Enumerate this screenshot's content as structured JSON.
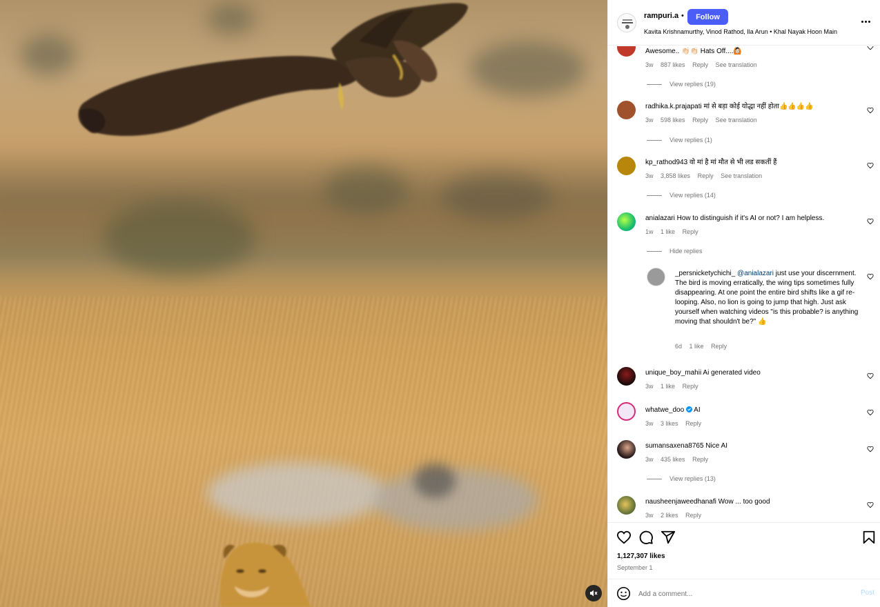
{
  "post": {
    "username": "rampuri.a",
    "separator": "•",
    "follow_label": "Follow",
    "audio": "Kavita Krishnamurthy, Vinod Rathod, Ila Arun • Khal Nayak Hoon Main",
    "avatar_icon": "profile-avatar-icon",
    "more_icon": "more-options-icon"
  },
  "comments": [
    {
      "username": "",
      "text": "Awesome.. 👏🏻👏🏻 Hats Off....🙆🏻",
      "time": "3w",
      "likes": "887 likes",
      "reply": "Reply",
      "translation": "See translation",
      "replies": "View replies (19)",
      "avatar_color": "#c0392b"
    },
    {
      "username": "radhika.k.prajapati",
      "text": "मां से बड़ा कोई योद्धा नहीं होता👍👍👍👍",
      "time": "3w",
      "likes": "598 likes",
      "reply": "Reply",
      "translation": "See translation",
      "replies": "View replies (1)",
      "avatar_color": "#a0522d"
    },
    {
      "username": "kp_rathod943",
      "text": "वो मां है मां मौत से भी लड सकतीं हैं",
      "time": "3w",
      "likes": "3,858 likes",
      "reply": "Reply",
      "translation": "See translation",
      "replies": "View replies (14)",
      "avatar_color": "#b8860b"
    },
    {
      "username": "anialazari",
      "text": "How to distinguish if it's AI or not? I am helpless.",
      "time": "1w",
      "likes": "1 like",
      "reply": "Reply",
      "replies": "Hide replies",
      "avatar_color": "#2ecc71"
    },
    {
      "username": "_persnicketychichi_",
      "mention": "@anialazari",
      "text": "just use your discernment. The bird is moving erratically, the wing tips sometimes fully disappearing. At one point the entire bird shifts like a gif re-looping. Also, no lion is going to jump that high. Just ask yourself when watching videos \"is this probable? is anything moving that shouldn't be?\" 👍",
      "time": "6d",
      "likes": "1 like",
      "reply": "Reply",
      "avatar_color": "#8e8e8e"
    },
    {
      "username": "unique_boy_mahii",
      "text": "Ai generated video",
      "time": "3w",
      "likes": "1 like",
      "reply": "Reply",
      "avatar_color": "#3b1f1f"
    },
    {
      "username": "whatwe_doo",
      "text": "AI",
      "time": "3w",
      "likes": "3 likes",
      "reply": "Reply",
      "avatar_color": "#e8d5f0"
    },
    {
      "username": "sumansaxena8765",
      "text": "Nice AI",
      "time": "3w",
      "likes": "435 likes",
      "reply": "Reply",
      "replies": "View replies (13)",
      "avatar_color": "#2c2c2c"
    },
    {
      "username": "nausheenjaweedhanafi",
      "text": "Wow ... too good",
      "time": "3w",
      "likes": "2 likes",
      "reply": "Reply",
      "avatar_color": "#6b7a3a"
    }
  ],
  "footer": {
    "likes": "1,127,307 likes",
    "date": "September 1",
    "comment_placeholder": "Add a comment...",
    "post_label": "Post"
  },
  "icons": {
    "like": "heart-icon",
    "comment": "comment-icon",
    "share": "share-icon",
    "save": "bookmark-icon",
    "emoji": "emoji-icon",
    "mute": "muted-audio-icon",
    "verified": "verified-badge-icon"
  },
  "colors": {
    "follow_button": "#4a5df9",
    "meta_text": "#737373",
    "mention": "#00376b",
    "verified": "#0095f6"
  }
}
